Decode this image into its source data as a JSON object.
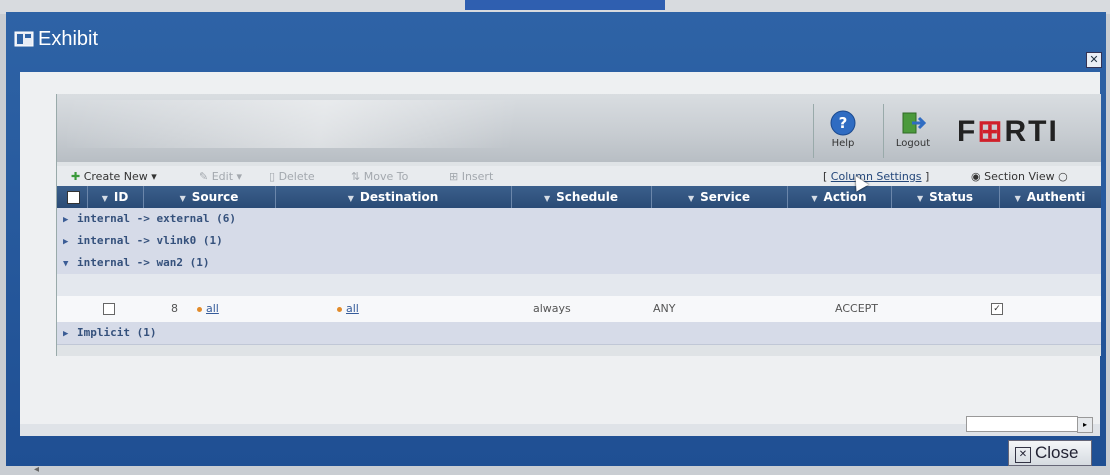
{
  "window": {
    "title": "Exhibit",
    "close_label": "Close"
  },
  "toolbar_top": {
    "help_label": "Help",
    "logout_label": "Logout",
    "brand_main": "F",
    "brand_accent": "⊞",
    "brand_rest": "RTI"
  },
  "actions": {
    "create_new": "Create New",
    "edit": "Edit",
    "delete": "Delete",
    "move_to": "Move To",
    "insert": "Insert",
    "column_settings": "Column Settings",
    "section_view": "Section View"
  },
  "columns": [
    "ID",
    "Source",
    "Destination",
    "Schedule",
    "Service",
    "Action",
    "Status",
    "Authenti"
  ],
  "groups": [
    {
      "label": "internal -> external (6)",
      "expanded": false
    },
    {
      "label": "internal -> vlink0 (1)",
      "expanded": false
    },
    {
      "label": "internal -> wan2 (1)",
      "expanded": true
    },
    {
      "label": "Implicit (1)",
      "expanded": false
    }
  ],
  "row": {
    "id": "8",
    "source": "all",
    "destination": "all",
    "schedule": "always",
    "service": "ANY",
    "action": "ACCEPT"
  },
  "colors": {
    "window_blue": "#2e63a6",
    "header_blue": "#2a4b76",
    "brand_red": "#d0202a"
  }
}
